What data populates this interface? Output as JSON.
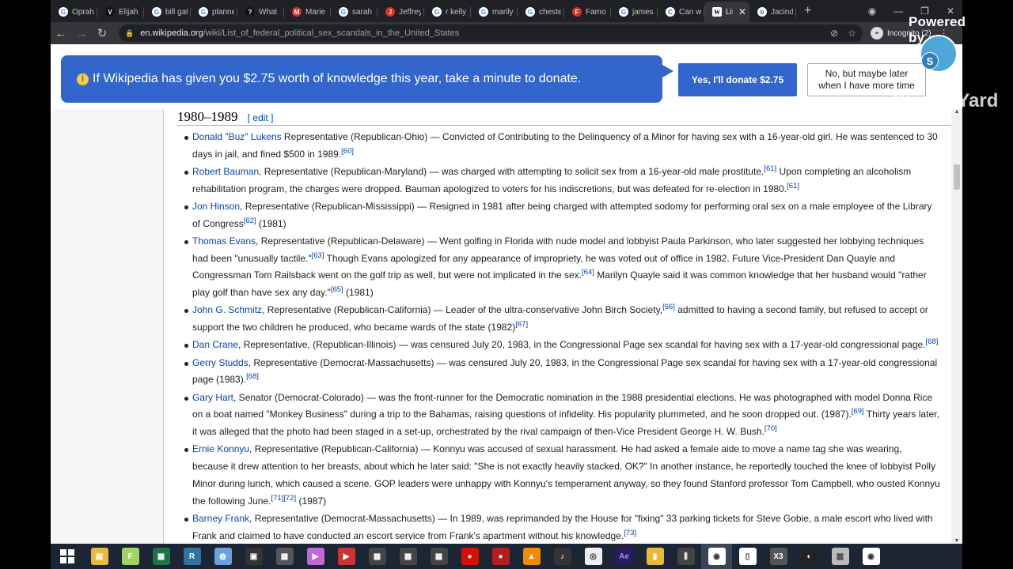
{
  "browser": {
    "tabs": [
      {
        "label": "Oprah",
        "favicon": "G"
      },
      {
        "label": "Elijah",
        "favicon": "V"
      },
      {
        "label": "bill gat",
        "favicon": "G"
      },
      {
        "label": "planne",
        "favicon": "G"
      },
      {
        "label": "What",
        "favicon": "?"
      },
      {
        "label": "Marie",
        "favicon": "M"
      },
      {
        "label": "sarah",
        "favicon": "G"
      },
      {
        "label": "Jeffrey",
        "favicon": "J"
      },
      {
        "label": "r kelly",
        "favicon": "G"
      },
      {
        "label": "marily",
        "favicon": "G"
      },
      {
        "label": "cheste",
        "favicon": "G"
      },
      {
        "label": "Famo",
        "favicon": "F"
      },
      {
        "label": "james",
        "favicon": "G"
      },
      {
        "label": "Can w",
        "favicon": "C"
      },
      {
        "label": "Lis",
        "favicon": "W"
      },
      {
        "label": "Jacind",
        "favicon": "b"
      }
    ],
    "new_tab": "+",
    "url_domain": "en.wikipedia.org",
    "url_path": "/wiki/List_of_federal_political_sex_scandals_in_the_United_States",
    "incognito_label": "Incognito (2)"
  },
  "donate": {
    "message": "If Wikipedia has given you $2.75 worth of knowledge this year, take a minute to donate.",
    "yes_button": "Yes, I'll donate $2.75",
    "no_line1": "No, but maybe later",
    "no_line2": "when I have more time"
  },
  "overlay": {
    "powered": "Powered by",
    "brand": "StreamYard",
    "badge": "S"
  },
  "section": {
    "heading": "1980–1989",
    "edit": "[ edit ]"
  },
  "entries": [
    {
      "link": "Donald \"Buz\" Lukens",
      "text": " Representative (Republican-Ohio) — Convicted of Contributing to the Delinquency of a Minor for having sex with a 16-year-old girl. He was sentenced to 30 days in jail, and fined $500 in 1989.",
      "ref": "[60]"
    },
    {
      "link": "Robert Bauman",
      "text": ", Representative (Republican-Maryland) — was charged with attempting to solicit sex from a 16-year-old male prostitute.",
      "ref": "[61]",
      "text2": " Upon completing an alcoholism rehabilitation program, the charges were dropped. Bauman apologized to voters for his indiscretions, but was defeated for re-election in 1980.",
      "ref2": "[61]"
    },
    {
      "link": "Jon Hinson",
      "text": ", Representative (Republican-Mississippi) — Resigned in 1981 after being charged with attempted sodomy for performing oral sex on a male employee of the Library of Congress",
      "ref": "[62]",
      "text2": " (1981)"
    },
    {
      "link": "Thomas Evans",
      "text": ", Representative (Republican-Delaware) — Went golfing in Florida with nude model and lobbyist Paula Parkinson, who later suggested her lobbying techniques had been \"unusually tactile.\"",
      "ref": "[63]",
      "text2": " Though Evans apologized for any appearance of impropriety, he was voted out of office in 1982. Future Vice-President Dan Quayle and Congressman Tom Railsback went on the golf trip as well, but were not implicated in the sex.",
      "ref2": "[64]",
      "text3": " Marilyn Quayle said it was common knowledge that her husband would \"rather play golf than have sex any day.\"",
      "ref3": "[65]",
      "text4": " (1981)"
    },
    {
      "link": "John G. Schmitz",
      "text": ", Representative (Republican-California) — Leader of the ultra-conservative John Birch Society,",
      "ref": "[66]",
      "text2": " admitted to having a second family, but refused to accept or support the two children he produced, who became wards of the state (1982)",
      "ref2": "[67]"
    },
    {
      "link": "Dan Crane",
      "text": ", Representative, (Republican-Illinois) — was censured July 20, 1983, in the Congressional Page sex scandal for having sex with a 17-year-old congressional page.",
      "ref": "[68]"
    },
    {
      "link": "Gerry Studds",
      "text": ", Representative (Democrat-Massachusetts) — was censured July 20, 1983, in the Congressional Page sex scandal for having sex with a 17-year-old congressional page (1983).",
      "ref": "[68]"
    },
    {
      "link": "Gary Hart",
      "text": ", Senator (Democrat-Colorado) — was the front-runner for the Democratic nomination in the 1988 presidential elections. He was photographed with model Donna Rice on a boat named \"Monkey Business\" during a trip to the Bahamas, raising questions of infidelity. His popularity plummeted, and he soon dropped out. (1987).",
      "ref": "[69]",
      "text2": " Thirty years later, it was alleged that the photo had been staged in a set-up, orchestrated by the rival campaign of then-Vice President George H. W. Bush.",
      "ref2": "[70]"
    },
    {
      "link": "Ernie Konnyu",
      "text": ", Representative (Republican-California) — Konnyu was accused of sexual harassment. He had asked a female aide to move a name tag she was wearing, because it drew attention to her breasts, about which he later said: \"She is not exactly heavily stacked, OK?\" In another instance, he reportedly touched the knee of lobbyist Polly Minor during lunch, which caused a scene. GOP leaders were unhappy with Konnyu's temperament anyway, so they found Stanford professor Tom Campbell, who ousted Konnyu the following June.",
      "ref": "[71][72]",
      "text2": " (1987)"
    },
    {
      "link": "Barney Frank",
      "text": ", Representative (Democrat-Massachusetts) — In 1989, was reprimanded by the House for \"fixing\" 33 parking tickets for Steve Gobie, a male escort who lived with Frank and claimed to have conducted an escort service from Frank's apartment without his knowledge.",
      "ref": "[73]"
    }
  ],
  "taskbar": {
    "icons": [
      "windows-start",
      "file-explorer",
      "notepad-plus",
      "excel",
      "python",
      "network",
      "video",
      "calculator",
      "media",
      "code",
      "grid-app-1",
      "grid-app-2",
      "grid-app-3",
      "lastfm",
      "music",
      "vlc",
      "guitar",
      "ccleaner",
      "after-effects",
      "folder-yellow",
      "audio-mixer",
      "chrome-active",
      "document",
      "x3",
      "obs",
      "files",
      "chrome"
    ],
    "x3_label": "X3",
    "ae_label": "Ae"
  }
}
